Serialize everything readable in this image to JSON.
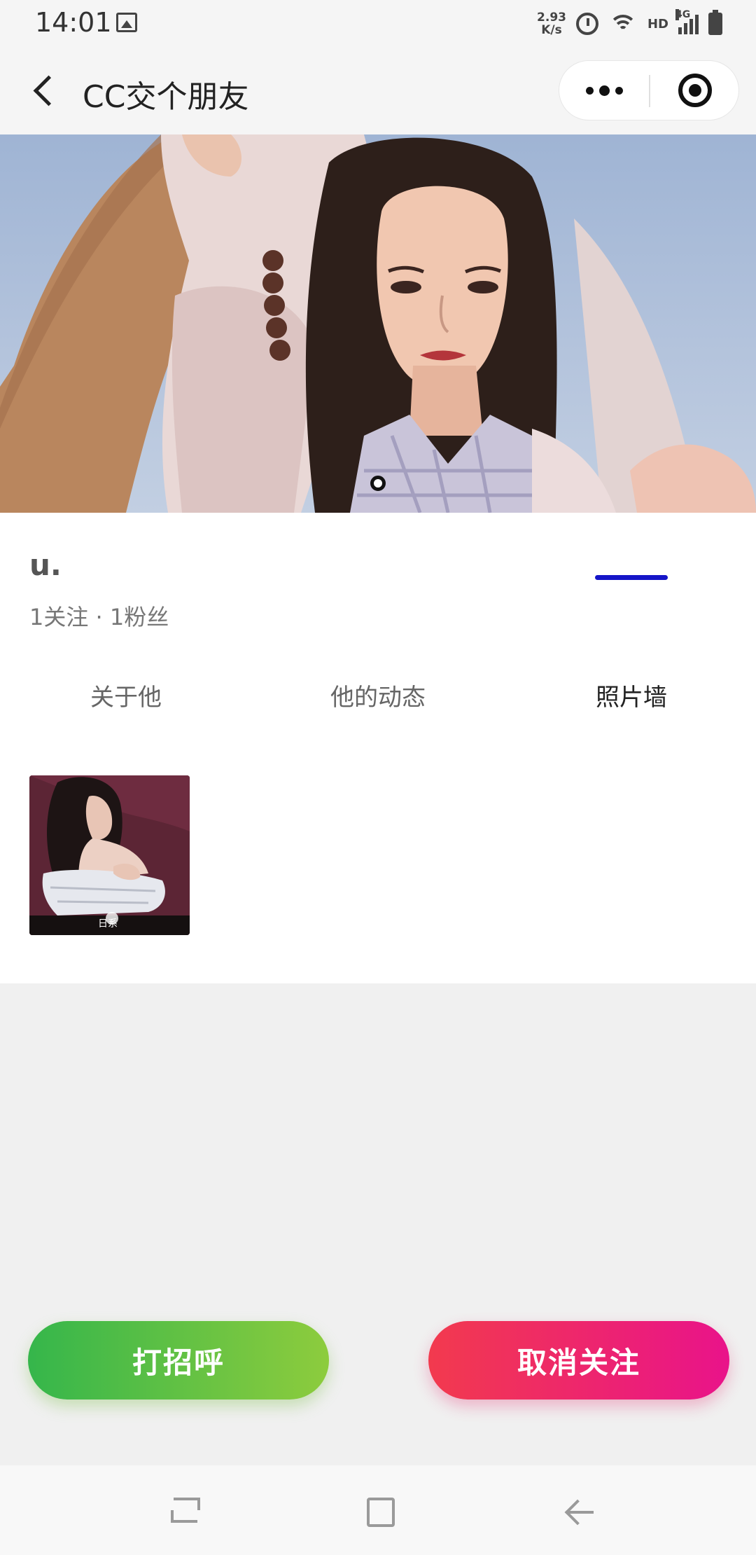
{
  "status_bar": {
    "time": "14:01",
    "speed_value": "2.93",
    "speed_unit": "K/s",
    "hd_label": "HD",
    "network_label": "4G",
    "icons": [
      "image-icon",
      "alarm-icon",
      "wifi-icon",
      "signal-icon",
      "battery-icon"
    ]
  },
  "nav": {
    "title": "CC交个朋友",
    "icons": [
      "back-icon",
      "more-icon",
      "close-miniprogram-icon"
    ]
  },
  "banner": {
    "slide_count": 1,
    "active_slide": 1
  },
  "profile": {
    "username": "u.",
    "stats": "1关注 · 1粉丝"
  },
  "tabs": [
    {
      "label": "关于他",
      "active": false
    },
    {
      "label": "他的动态",
      "active": false
    },
    {
      "label": "照片墙",
      "active": true
    }
  ],
  "photo_wall": {
    "photo_count": 1,
    "watermark_text": "日系"
  },
  "actions": {
    "greet_label": "打招呼",
    "unfollow_label": "取消关注"
  },
  "colors": {
    "tab_accent": "#1515c8",
    "greet_gradient": [
      "#35b64b",
      "#8dcc3d"
    ],
    "unfollow_gradient": [
      "#f23a4e",
      "#e9138a"
    ]
  }
}
